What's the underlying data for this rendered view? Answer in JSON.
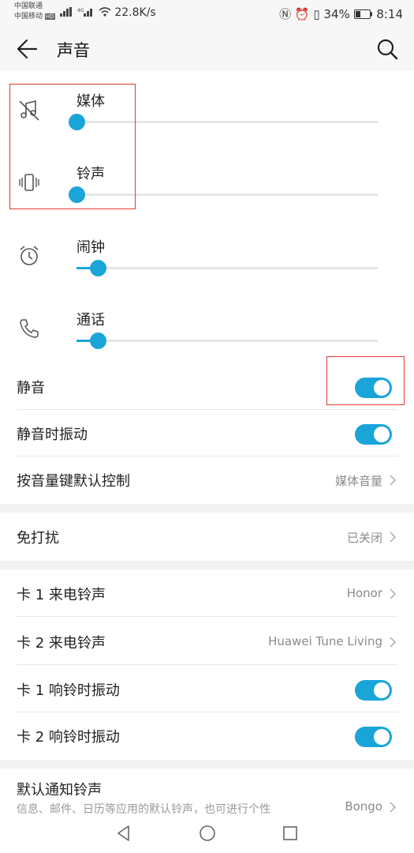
{
  "status_bar": {
    "carrier1": "中国联通",
    "carrier2": "中国移动",
    "hd": "HD",
    "net_speed": "22.8K/s",
    "battery": "34%",
    "time": "8:14"
  },
  "header": {
    "title": "声音",
    "back_icon": "arrow-left-icon",
    "search_icon": "search-icon"
  },
  "volumes": [
    {
      "label": "媒体",
      "icon": "music-off-icon",
      "level": 0
    },
    {
      "label": "铃声",
      "icon": "vibrate-icon",
      "level": 0
    },
    {
      "label": "闹钟",
      "icon": "alarm-icon",
      "level": 0.07
    },
    {
      "label": "通话",
      "icon": "phone-icon",
      "level": 0.07
    }
  ],
  "settings": {
    "mute": {
      "label": "静音",
      "on": true
    },
    "vibrate_on_mute": {
      "label": "静音时振动",
      "on": true
    },
    "volume_key": {
      "label": "按音量键默认控制",
      "value": "媒体音量"
    },
    "dnd": {
      "label": "免打扰",
      "value": "已关闭"
    },
    "sim1_ringtone": {
      "label": "卡 1 来电铃声",
      "value": "Honor"
    },
    "sim2_ringtone": {
      "label": "卡 2 来电铃声",
      "value": "Huawei Tune Living"
    },
    "sim1_vibrate": {
      "label": "卡 1 响铃时振动",
      "on": true
    },
    "sim2_vibrate": {
      "label": "卡 2 响铃时振动",
      "on": true
    },
    "notification": {
      "label": "默认通知铃声",
      "desc": "信息、邮件、日历等应用的默认铃声，也可进行个性",
      "value": "Bongo"
    }
  },
  "colors": {
    "accent": "#1aa5d8",
    "highlight_box": "#e53935"
  }
}
